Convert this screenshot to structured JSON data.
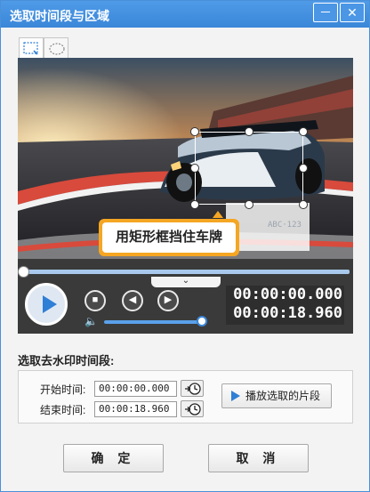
{
  "window": {
    "title": "选取时间段与区域",
    "minimize_label": "－",
    "close_label": "✕"
  },
  "shape_tabs": [
    {
      "name": "rectangle",
      "icon": "rect-select-icon",
      "active": true
    },
    {
      "name": "ellipse",
      "icon": "ellipse-select-icon",
      "active": false
    }
  ],
  "preview": {
    "mask_hint": "用矩形框挡住车牌",
    "plate_text": "ABC·123"
  },
  "player": {
    "seek_progress": 0.0,
    "volume_level": 1.0,
    "current_time": "00:00:00.000",
    "total_time": "00:00:18.960",
    "stop_icon": "■",
    "prev_frame_icon": "◀",
    "next_frame_icon": "▶",
    "speaker_icon": "🔈",
    "collapse_icon": "⌄"
  },
  "segment": {
    "section_title": "选取去水印时间段:",
    "start_label": "开始时间:",
    "start_value": "00:00:00.000",
    "end_label": "结束时间:",
    "end_value": "00:00:18.960",
    "play_selected_label": "播放选取的片段"
  },
  "footer": {
    "ok_label": "确 定",
    "cancel_label": "取 消"
  },
  "colors": {
    "accent": "#3a86d8",
    "tip": "#f5a623",
    "player_bg": "#3a3a3a"
  }
}
